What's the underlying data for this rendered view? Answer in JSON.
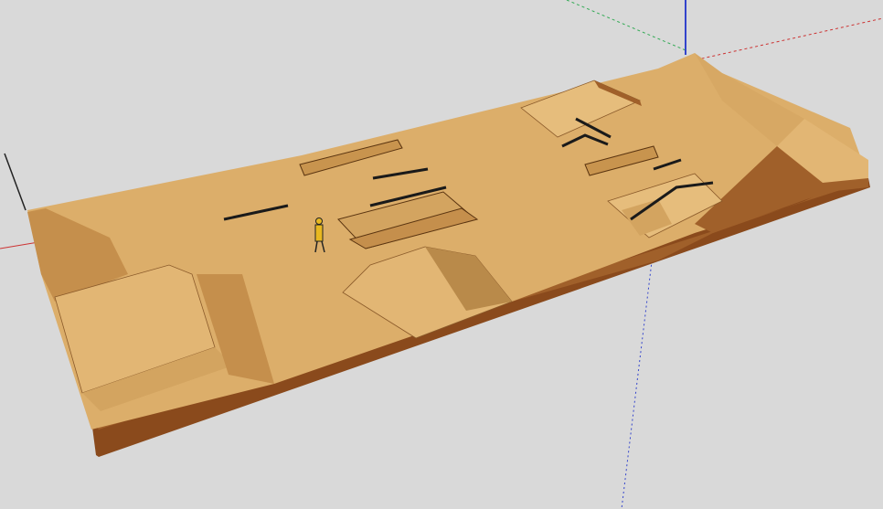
{
  "scene": {
    "description_type": "3d-model-view",
    "colors": {
      "background": "#d9d9d9",
      "wood_top": "#dcae6a",
      "wood_light": "#e8c184",
      "wood_shadow": "#b98a4a",
      "side_dark": "#8a4a1c",
      "side_mid": "#a0602a",
      "rail": "#1a1a1a",
      "axis_red": "#cc3333",
      "axis_green": "#33aa55",
      "axis_blue": "#3344cc",
      "figure_yellow": "#e8b820"
    }
  }
}
